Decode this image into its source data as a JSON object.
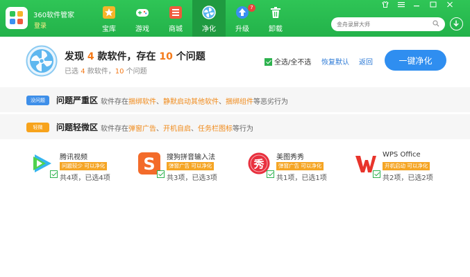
{
  "app": {
    "title": "360软件管家",
    "login": "登录"
  },
  "nav": [
    {
      "label": "宝库",
      "icon": "treasure-star-icon",
      "color": "#f5b52a"
    },
    {
      "label": "游戏",
      "icon": "gamepad-icon",
      "color": "#ffffff"
    },
    {
      "label": "商城",
      "icon": "store-icon",
      "color": "#ef5a3d"
    },
    {
      "label": "净化",
      "icon": "fan-purify-icon",
      "color": "#5bb6f0"
    },
    {
      "label": "升级",
      "icon": "upgrade-arrow-icon",
      "color": "#3b8ff0",
      "badge": "7"
    },
    {
      "label": "卸载",
      "icon": "trash-icon",
      "color": "#ffffff"
    }
  ],
  "search": {
    "placeholder": "金舟录屏大师"
  },
  "summary": {
    "title_pre": "发现 ",
    "software_count": "4",
    "title_mid": " 款软件，存在 ",
    "issue_count": "10",
    "title_post": " 个问题",
    "sub_pre": "已选 ",
    "sub_software": "4",
    "sub_mid": " 款软件，",
    "sub_issues": "10",
    "sub_post": " 个问题",
    "select_all": "全选/全不选",
    "restore": "恢复默认",
    "back": "返回",
    "purify_button": "一键净化"
  },
  "categories": [
    {
      "tag": "没问题",
      "tag_color": "#3e8fe9",
      "title": "问题严重区",
      "desc_pre": "软件存在",
      "h1": "捆绑软件",
      "sep1": "、",
      "h2": "静默启动其他软件",
      "sep2": "、",
      "h3": "捆绑组件",
      "desc_post": "等恶劣行为"
    },
    {
      "tag": "轻微",
      "tag_color": "#f7a31c",
      "title": "问题轻微区",
      "desc_pre": "软件存在",
      "h1": "弹窗广告",
      "sep1": "、",
      "h2": "开机自启",
      "sep2": "、",
      "h3": "任务栏图标",
      "desc_post": "等行为"
    }
  ],
  "apps": [
    {
      "name": "腾讯视频",
      "tag": "问题较少 可以净化",
      "count": "共4项，已选4项",
      "icon": "tencent-video-icon"
    },
    {
      "name": "搜狗拼音输入法",
      "tag": "弹窗广告 可以净化",
      "count": "共3项，已选3项",
      "icon": "sogou-input-icon"
    },
    {
      "name": "美图秀秀",
      "tag": "弹窗广告 可以净化",
      "count": "共1项，已选1项",
      "icon": "meitu-xiuxiu-icon"
    },
    {
      "name": "WPS Office",
      "tag": "开机启动 可以净化",
      "count": "共2项，已选2项",
      "icon": "wps-office-icon"
    }
  ]
}
